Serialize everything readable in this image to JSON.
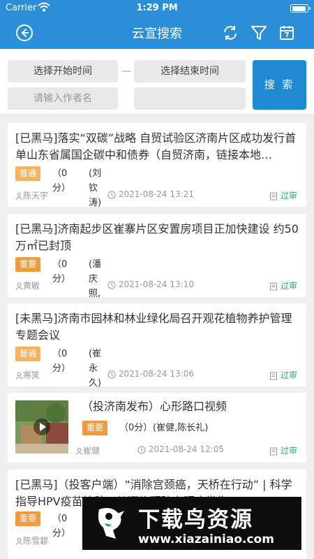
{
  "statusbar": {
    "carrier": "Carrier",
    "time": "1:29 PM",
    "battery_level": 0.92
  },
  "navbar": {
    "title": "云宣搜索",
    "icons": [
      "back-icon",
      "refresh-icon",
      "filter-icon",
      "calendar-icon"
    ]
  },
  "search": {
    "start_placeholder": "选择开始时间",
    "dash": "—",
    "end_placeholder": "选择结束时间",
    "author_placeholder": "请输入作者名",
    "button_label": "搜 索"
  },
  "colors": {
    "header": "#2a8fd6",
    "search_button": "#1f89d4",
    "badge": "#f39a3c",
    "status_green": "#2aab6f"
  },
  "cards": [
    {
      "title": "[已黑马]落实“双碳”战略 自贸试验区济南片区成功发行首单山东省属国企碳中和债券（自贸济南，链接本地…",
      "badge": "普通",
      "score": "（0分）",
      "editors": "(刘钦涛)",
      "author": "陈天宇",
      "time": "2021-08-24 13:21",
      "status": "过审"
    },
    {
      "title": "[已黑马]济南起步区崔寨片区安置房项目正加快建设 约50万㎡已封顶",
      "badge": "重要",
      "score": "（0分）",
      "editors": "(潘庆照,校对)",
      "author": "黄敏",
      "time": "2021-08-24 13:10",
      "status": "过审"
    },
    {
      "title": "[未黑马]济南市园林和林业绿化局召开观花植物养护管理专题会议",
      "badge": "普通",
      "score": "（0分）",
      "editors": "(崔永久)",
      "author": "寒笑",
      "time": "2021-08-24 13:06",
      "status": "过审"
    },
    {
      "title": "（投济南发布）心形路口视频",
      "badge": "重要",
      "score": "（0分）",
      "editors": "(崔健,陈长礼)",
      "author": "崔健",
      "time": "2021-08-24 12:05",
      "status": "过审"
    },
    {
      "title": "[已黑马]（投客户端）“消除宫颈癌，天桥在行动” | 科学指导HPV疫苗接种，从源头预防宫颈癌发生",
      "badge": "重要",
      "score": "（0分）",
      "author": "陈雪碧"
    }
  ],
  "watermark": {
    "title": "下载鸟资源",
    "url": "www.xiazainiao.com"
  }
}
